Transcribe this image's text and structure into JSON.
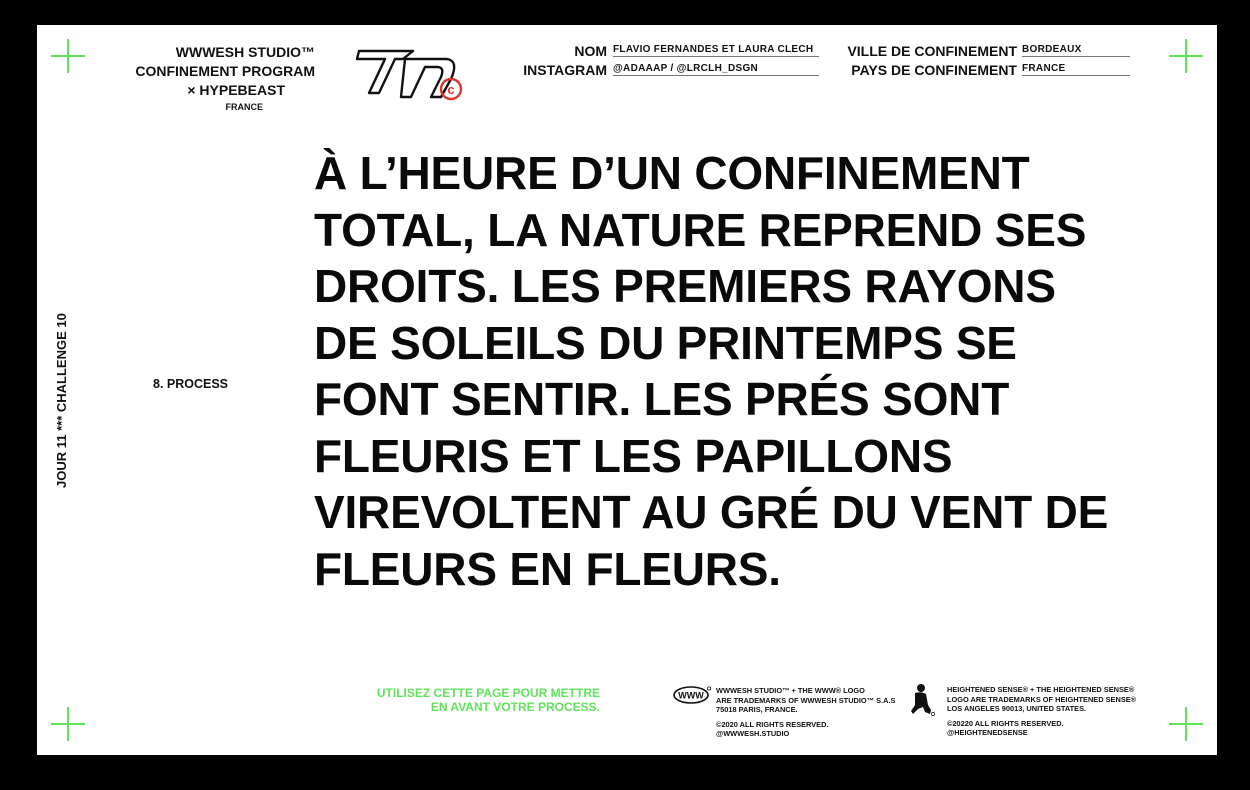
{
  "header": {
    "studio_line1": "WWWESH STUDIO™",
    "studio_line2": "CONFINEMENT PROGRAM",
    "studio_line3": "× HYPEBEAST",
    "studio_line4": "FRANCE",
    "logo_icon": "wwwesh-monogram-logo",
    "fields": {
      "nom_label": "NOM",
      "nom_value": "FLAVIO FERNANDES ET LAURA CLECH",
      "instagram_label": "INSTAGRAM",
      "instagram_value": "@ADAAAP / @LRCLH_DSGN",
      "ville_label": "VILLE DE CONFINEMENT",
      "ville_value": "BORDEAUX",
      "pays_label": "PAYS DE CONFINEMENT",
      "pays_value": "FRANCE"
    }
  },
  "sidebar": {
    "vertical_text": "JOUR 11 *** CHALLENGE 10",
    "section": "8. PROCESS"
  },
  "main": {
    "lines": [
      "À L’HEURE D’UN CONFINEMENT",
      "TOTAL, LA NATURE REPREND SES",
      "DROITS. LES PREMIERS RAYONS",
      "DE SOLEILS DU PRINTEMPS SE",
      "FONT SENTIR. LES PRÉS SONT",
      "FLEURIS ET LES PAPILLONS",
      "VIREVOLTENT AU GRÉ DU VENT DE",
      "FLEURS EN FLEURS."
    ]
  },
  "footer": {
    "note_line1": "UTILISEZ CETTE PAGE POUR METTRE",
    "note_line2": "EN AVANT VOTRE PROCESS.",
    "www_logo": "WWW",
    "www_legal": [
      "WWWESH STUDIO™ + THE WWW® LOGO",
      "ARE TRADEMARKS OF WWWESH STUDIO™ S.A.S",
      "75018 PARIS, FRANCE."
    ],
    "www_rights": [
      "©2020 ALL RIGHTS RESERVED.",
      "@WWWESH.STUDIO"
    ],
    "hs_legal": [
      "HEIGHTENED SENSE® + THE HEIGHTENED SENSE®",
      "LOGO ARE TRADEMARKS OF HEIGHTENED SENSE®",
      "LOS ANGELES 90013, UNITED STATES."
    ],
    "hs_rights": [
      "©20220 ALL RIGHTS RESERVED.",
      "@HEIGHTENEDSENSE"
    ]
  },
  "colors": {
    "accent_green": "#5fe35a",
    "accent_red": "#e0322e",
    "text": "#0a0a0a"
  }
}
